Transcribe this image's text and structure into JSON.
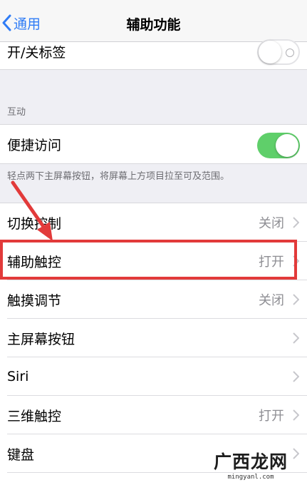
{
  "nav": {
    "back_label": "通用",
    "title": "辅助功能"
  },
  "top_group": {
    "tab_label_toggle": "开/关标签"
  },
  "interaction_section": {
    "header": "互动",
    "easy_access_label": "便捷访问",
    "easy_access_note": "轻点两下主屏幕按钮，将屏幕上方项目拉至可及范围。"
  },
  "settings_rows": [
    {
      "label": "切换控制",
      "value": "关闭"
    },
    {
      "label": "辅助触控",
      "value": "打开"
    },
    {
      "label": "触摸调节",
      "value": "关闭"
    },
    {
      "label": "主屏幕按钮",
      "value": ""
    },
    {
      "label": "Siri",
      "value": ""
    },
    {
      "label": "三维触控",
      "value": "打开"
    },
    {
      "label": "键盘",
      "value": ""
    }
  ],
  "watermark": {
    "main": "广西龙网",
    "sub": "mingyanl.com"
  },
  "colors": {
    "accent": "#2f7cf6",
    "toggle_on": "#5fcf6a",
    "annotation": "#e23a3a"
  }
}
